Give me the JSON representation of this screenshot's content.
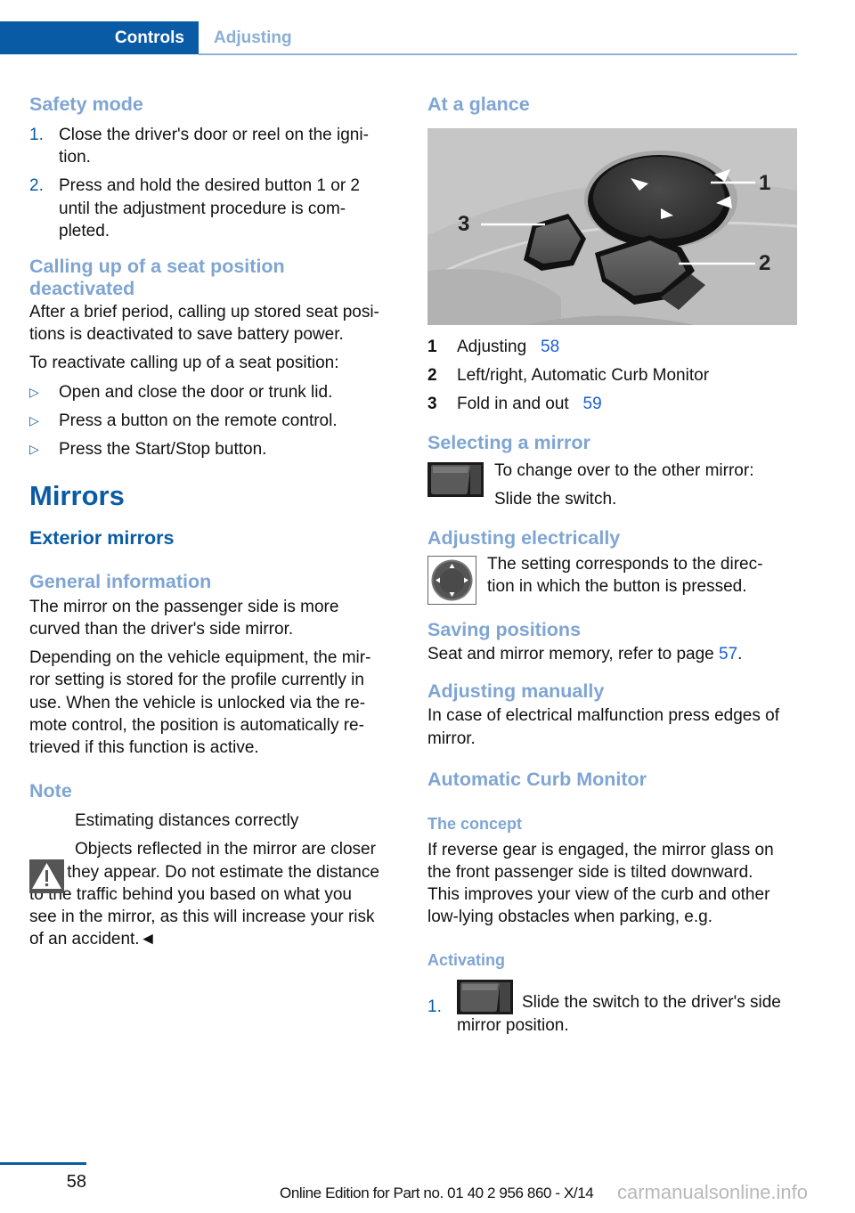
{
  "header": {
    "active_tab": "Controls",
    "tab": "Adjusting"
  },
  "left": {
    "safety_mode": {
      "title": "Safety mode",
      "steps": [
        {
          "num": "1.",
          "line1": "Close the driver's door or reel on the igni-",
          "line2": "tion."
        },
        {
          "num": "2.",
          "line1": "Press and hold the desired button 1 or 2",
          "line2": "until the adjustment procedure is com-",
          "line3": "pleted."
        }
      ]
    },
    "deactivated": {
      "title_line1": "Calling up of a seat position",
      "title_line2": "deactivated",
      "para1_line1": "After a brief period, calling up stored seat posi-",
      "para1_line2": "tions is deactivated to save battery power.",
      "para2": "To reactivate calling up of a seat position:",
      "bullets": [
        "Open and close the door or trunk lid.",
        "Press a button on the remote control.",
        "Press the Start/Stop button."
      ],
      "bullet_icon": "▷"
    },
    "mirrors": {
      "title": "Mirrors",
      "exterior_title": "Exterior mirrors",
      "general_title": "General information",
      "general_p1_line1": "The mirror on the passenger side is more",
      "general_p1_line2": "curved than the driver's side mirror.",
      "general_p2_lines": [
        "Depending on the vehicle equipment, the mir-",
        "ror setting is stored for the profile currently in",
        "use. When the vehicle is unlocked via the re-",
        "mote control, the position is automatically re-",
        "trieved if this function is active."
      ]
    },
    "note": {
      "title": "Note",
      "warning_heading": "Estimating distances correctly",
      "warning_line1": "Objects reflected in the mirror are closer",
      "warning_lines": [
        "than they appear. Do not estimate the distance",
        "to the traffic behind you based on what you",
        "see in the mirror, as this will increase your risk",
        "of an accident.◄"
      ]
    }
  },
  "right": {
    "at_a_glance": {
      "title": "At a glance",
      "callouts": [
        "1",
        "2",
        "3"
      ],
      "legend": [
        {
          "num": "1",
          "text": "Adjusting",
          "page": "58"
        },
        {
          "num": "2",
          "text": "Left/right, Automatic Curb Monitor",
          "page": ""
        },
        {
          "num": "3",
          "text": "Fold in and out",
          "page": "59"
        }
      ]
    },
    "selecting": {
      "title": "Selecting a mirror",
      "line1": "To change over to the other mirror:",
      "line2": "Slide the switch."
    },
    "electrically": {
      "title": "Adjusting electrically",
      "line1": "The setting corresponds to the direc-",
      "line2": "tion in which the button is pressed."
    },
    "saving": {
      "title": "Saving positions",
      "text_before": "Seat and mirror memory, refer to page ",
      "page": "57",
      "text_after": "."
    },
    "manually": {
      "title": "Adjusting manually",
      "line1": "In case of electrical malfunction press edges of",
      "line2": "mirror."
    },
    "curb": {
      "title": "Automatic Curb Monitor",
      "concept_title": "The concept",
      "concept_lines": [
        "If reverse gear is engaged, the mirror glass on",
        "the front passenger side is tilted downward.",
        "This improves your view of the curb and other",
        "low-lying obstacles when parking, e.g."
      ],
      "activating_title": "Activating",
      "step_num": "1.",
      "step_line1": "Slide the switch to the driver's side",
      "step_line2": "mirror position."
    }
  },
  "footer": {
    "page_number": "58",
    "edition": "Online Edition for Part no. 01 40 2 956 860 - X/14",
    "watermark": "carmanualsonline.info"
  },
  "colors": {
    "brand_blue": "#0a5ba6",
    "light_heading": "#7fa5d3",
    "link": "#1a5fd6"
  }
}
